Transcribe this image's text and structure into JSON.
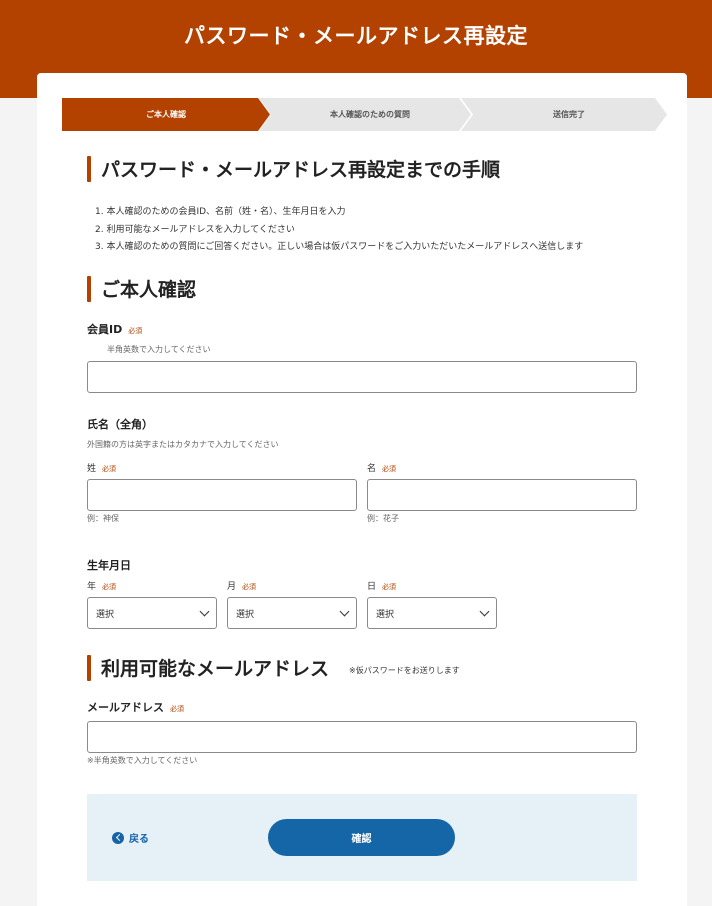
{
  "header": {
    "title": "パスワード・メールアドレス再設定"
  },
  "stepper": {
    "steps": [
      {
        "label": "ご本人確認",
        "active": true
      },
      {
        "label": "本人確認のための質問",
        "active": false
      },
      {
        "label": "送信完了",
        "active": false
      }
    ]
  },
  "procedure": {
    "title": "パスワード・メールアドレス再設定までの手順",
    "items": [
      "1. 本人確認のための会員ID、名前（姓・名）、生年月日を入力",
      "2. 利用可能なメールアドレスを入力してください",
      "3. 本人確認のための質問にご回答ください。正しい場合は仮パスワードをご入力いただいたメールアドレスへ送信します"
    ]
  },
  "identity": {
    "title": "ご本人確認",
    "required": "必須",
    "member_id": {
      "label": "会員ID",
      "hint": "半角英数で入力してください",
      "value": ""
    },
    "name": {
      "label": "氏名（全角）",
      "hint": "外国籍の方は英字またはカタカナで入力してください",
      "last": {
        "label": "姓",
        "example": "例：神保",
        "value": ""
      },
      "first": {
        "label": "名",
        "example": "例：花子",
        "value": ""
      }
    },
    "birth": {
      "label": "生年月日",
      "year": {
        "label": "年",
        "value": "選択"
      },
      "month": {
        "label": "月",
        "value": "選択"
      },
      "day": {
        "label": "日",
        "value": "選択"
      }
    }
  },
  "email": {
    "title": "利用可能なメールアドレス",
    "note": "※仮パスワードをお送りします",
    "label": "メールアドレス",
    "hint": "※半角英数で入力してください",
    "value": ""
  },
  "footer": {
    "back_label": "戻る",
    "confirm_label": "確認"
  },
  "colors": {
    "brand": "#b34100",
    "accent": "#1466a6",
    "footer_bg": "#e6f0f7"
  }
}
